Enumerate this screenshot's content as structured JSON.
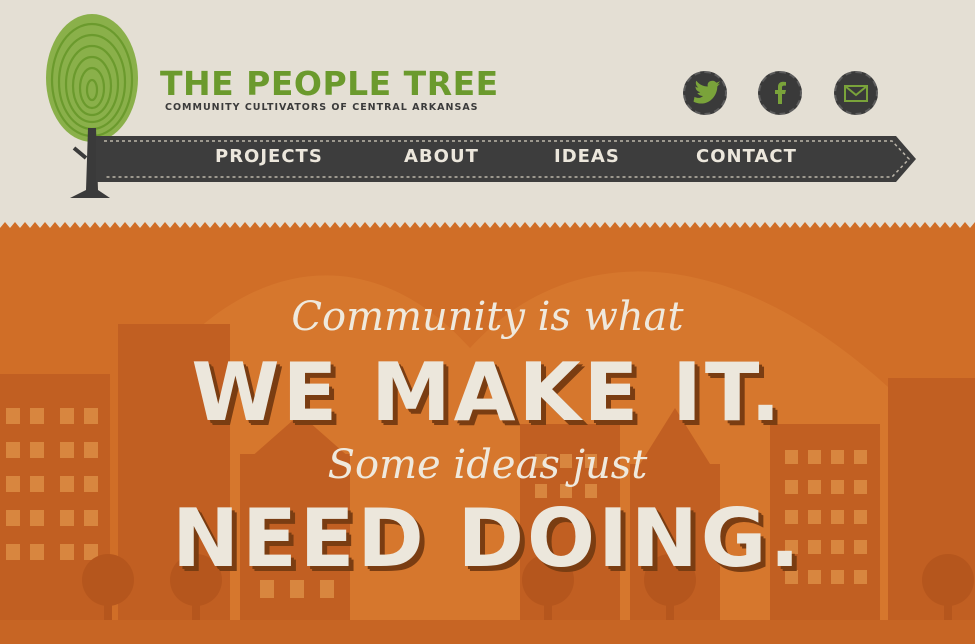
{
  "header": {
    "title": "THE PEOPLE TREE",
    "tagline": "COMMUNITY CULTIVATORS OF CENTRAL ARKANSAS",
    "logo_icon": "fingerprint-tree-icon",
    "social": [
      {
        "icon": "twitter-icon"
      },
      {
        "icon": "facebook-icon"
      },
      {
        "icon": "mail-icon"
      }
    ]
  },
  "nav": {
    "items": [
      {
        "label": "PROJECTS"
      },
      {
        "label": "ABOUT"
      },
      {
        "label": "IDEAS"
      },
      {
        "label": "CONTACT"
      }
    ]
  },
  "hero": {
    "line1": "Community is what",
    "line2": "WE MAKE IT.",
    "line3": "Some ideas just",
    "line4": "NEED DOING."
  },
  "colors": {
    "brand_green": "#6b9a2d",
    "hero_orange": "#d06e27",
    "nav_dark": "#3d3d3d",
    "paper": "#e4dfd4"
  }
}
